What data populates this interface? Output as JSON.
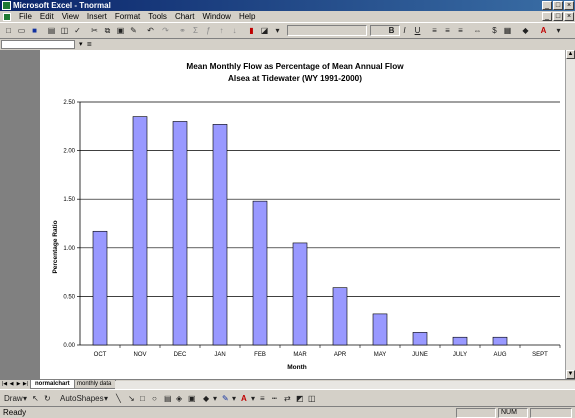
{
  "window": {
    "title": "Microsoft Excel - Tnormal"
  },
  "menu": [
    "File",
    "Edit",
    "View",
    "Insert",
    "Format",
    "Tools",
    "Chart",
    "Window",
    "Help"
  ],
  "formula_bar": {
    "separator": "▾",
    "equals": "="
  },
  "chart_data": {
    "type": "bar",
    "title": "Mean Monthly Flow as Percentage of Mean Annual Flow",
    "subtitle": "Alsea at Tidewater (WY 1991-2000)",
    "xlabel": "Month",
    "ylabel": "Percentage Ratio",
    "categories": [
      "OCT",
      "NOV",
      "DEC",
      "JAN",
      "FEB",
      "MAR",
      "APR",
      "MAY",
      "JUNE",
      "JULY",
      "AUG",
      "SEPT"
    ],
    "values": [
      1.17,
      2.35,
      2.3,
      2.27,
      1.48,
      1.05,
      0.59,
      0.32,
      0.13,
      0.08,
      0.08,
      0.0
    ],
    "ylim": [
      0,
      2.5
    ],
    "yticks": [
      "0.00",
      "0.50",
      "1.00",
      "1.50",
      "2.00",
      "2.50"
    ],
    "grid": true,
    "bar_color": "#9999ff",
    "bar_outline": "#000000"
  },
  "sheet_tabs": {
    "active": "normalchart",
    "other": "monthly data"
  },
  "drawing_toolbar": {
    "draw": "Draw",
    "autoshapes": "AutoShapes"
  },
  "status": {
    "text": "Ready",
    "num": "NUM"
  }
}
